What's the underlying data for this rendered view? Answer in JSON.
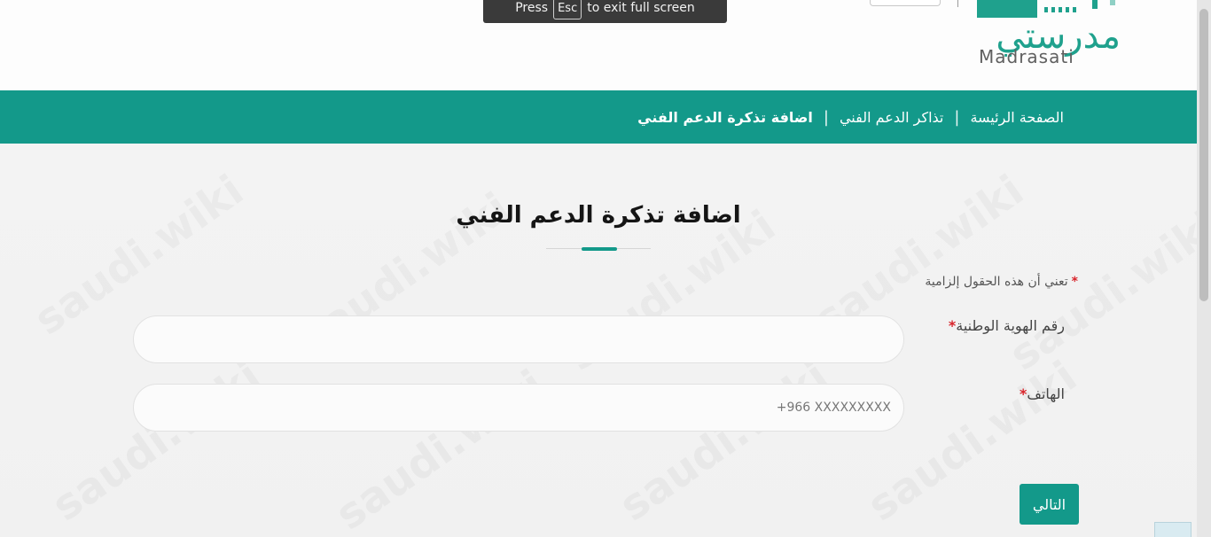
{
  "fullscreen_notice": {
    "press": "Press",
    "key": "Esc",
    "rest": "to exit full screen"
  },
  "logo": {
    "arabic": "مدرستي",
    "latin": "Madrasati"
  },
  "breadcrumb": {
    "home": "الصفحة الرئيسة",
    "tickets": "تذاكر الدعم الفني",
    "current": "اضافة تذكرة الدعم الفني",
    "separator": "|"
  },
  "form": {
    "title": "اضافة تذكرة الدعم الفني",
    "required_note": "تعني أن هذه الحقول إلزامية",
    "required_star": "*",
    "national_id_label": "رقم الهوية الوطنية",
    "phone_label": "الهاتف",
    "national_id_value": "",
    "phone_placeholder": "+966 XXXXXXXXX",
    "next_label": "التالي"
  },
  "watermark": "saudi.wiki",
  "colors": {
    "accent": "#13998a",
    "required": "#d8232a"
  }
}
